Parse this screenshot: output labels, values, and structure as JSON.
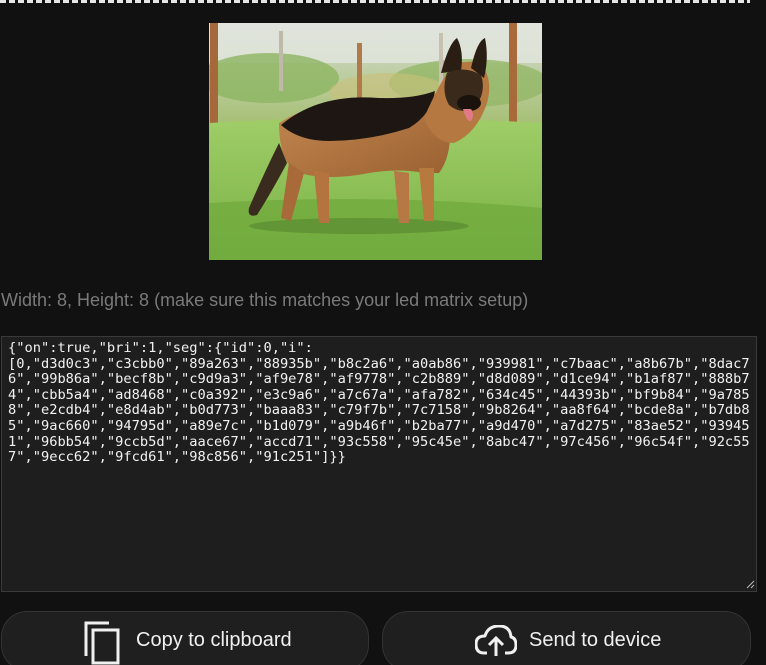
{
  "image": {
    "subject": "german-shepherd-dog"
  },
  "matrix_info": "Width: 8, Height: 8 (make sure this matches your led matrix setup)",
  "json_output": "{\"on\":true,\"bri\":1,\"seg\":{\"id\":0,\"i\":\n[0,\"d3d0c3\",\"c3cbb0\",\"89a263\",\"88935b\",\"b8c2a6\",\"a0ab86\",\"939981\",\"c7baac\",\"a8b67b\",\"8dac76\",\"99b86a\",\"becf8b\",\"c9d9a3\",\"af9e78\",\"af9778\",\"c2b889\",\"d8d089\",\"d1ce94\",\"b1af87\",\"888b74\",\"cbb5a4\",\"ad8468\",\"c0a392\",\"e3c9a6\",\"a7c67a\",\"afa782\",\"634c45\",\"44393b\",\"bf9b84\",\"9a7858\",\"e2cdb4\",\"e8d4ab\",\"b0d773\",\"baaa83\",\"c79f7b\",\"7c7158\",\"9b8264\",\"aa8f64\",\"bcde8a\",\"b7db85\",\"9ac660\",\"94795d\",\"a89e7c\",\"b1d079\",\"a9b46f\",\"b2ba77\",\"a9d470\",\"a7d275\",\"83ae52\",\"939451\",\"96bb54\",\"9ccb5d\",\"aace67\",\"accd71\",\"93c558\",\"95c45e\",\"8abc47\",\"97c456\",\"96c54f\",\"92c557\",\"9ecc62\",\"9fcd61\",\"98c856\",\"91c251\"]}}",
  "buttons": {
    "copy_label": "Copy to clipboard",
    "send_label": "Send to device"
  },
  "colors": {
    "background": "#111111",
    "textarea_bg": "#1e1e1e",
    "button_bg": "#1f1f1f",
    "muted_text": "#7a7a7a"
  }
}
